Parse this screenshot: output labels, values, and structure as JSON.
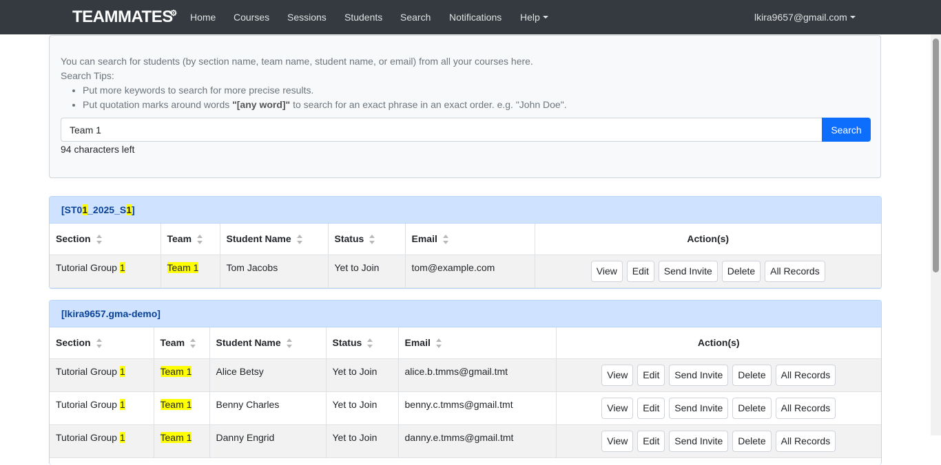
{
  "navbar": {
    "brand": "TEAMMATES",
    "items": [
      "Home",
      "Courses",
      "Sessions",
      "Students",
      "Search",
      "Notifications"
    ],
    "help": "Help",
    "user": "lkira9657@gmail.com"
  },
  "search": {
    "intro": "You can search for students (by section name, team name, student name, or email) from all your courses here.",
    "tips_title": "Search Tips:",
    "tip1": "Put more keywords to search for more precise results.",
    "tip2_pre": "Put quotation marks around words ",
    "tip2_bold": "\"[any word]\"",
    "tip2_post": " to search for an exact phrase in an exact order. e.g. \"John Doe\".",
    "value": "Team 1",
    "button": "Search",
    "chars_left": "94 characters left"
  },
  "columns": {
    "section": "Section",
    "team": "Team",
    "name": "Student Name",
    "status": "Status",
    "email": "Email",
    "actions": "Action(s)"
  },
  "actions": [
    "View",
    "Edit",
    "Send Invite",
    "Delete",
    "All Records"
  ],
  "courses": [
    {
      "id_pre": "[ST0",
      "id_m1": "1",
      "id_mid": "_2025_S",
      "id_m2": "1",
      "id_post": "]",
      "rows": [
        {
          "section_pre": "Tutorial Group ",
          "section_num": "1",
          "team": "Team 1",
          "name": "Tom Jacobs",
          "status": "Yet to Join",
          "email": "tom@example.com"
        }
      ]
    },
    {
      "id": "[lkira9657.gma-demo]",
      "rows": [
        {
          "section_pre": "Tutorial Group ",
          "section_num": "1",
          "team": "Team 1",
          "name": "Alice Betsy",
          "status": "Yet to Join",
          "email": "alice.b.tmms@gmail.tmt"
        },
        {
          "section_pre": "Tutorial Group ",
          "section_num": "1",
          "team": "Team 1",
          "name": "Benny Charles",
          "status": "Yet to Join",
          "email": "benny.c.tmms@gmail.tmt"
        },
        {
          "section_pre": "Tutorial Group ",
          "section_num": "1",
          "team": "Team 1",
          "name": "Danny Engrid",
          "status": "Yet to Join",
          "email": "danny.e.tmms@gmail.tmt"
        }
      ]
    }
  ]
}
